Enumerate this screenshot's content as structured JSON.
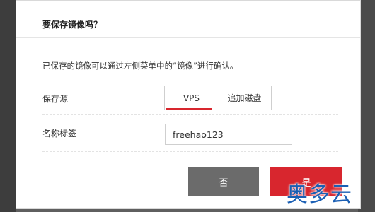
{
  "dialog": {
    "title": "要保存镜像吗？",
    "description": "已保存的镜像可以通过左侧菜单中的“镜像”进行确认。",
    "source_label": "保存源",
    "source_tabs": [
      {
        "label": "VPS",
        "active": true
      },
      {
        "label": "追加磁盘",
        "active": false
      }
    ],
    "tag_label": "名称标签",
    "tag_value": "freehao123",
    "cancel_label": "否",
    "confirm_label": "是"
  },
  "watermark": {
    "text": "奥多云"
  },
  "colors": {
    "accent": "#d8262e",
    "cancel_bg": "#6b6b6b",
    "backdrop": "#5f5f5f",
    "watermark": "#1a5fb4"
  }
}
